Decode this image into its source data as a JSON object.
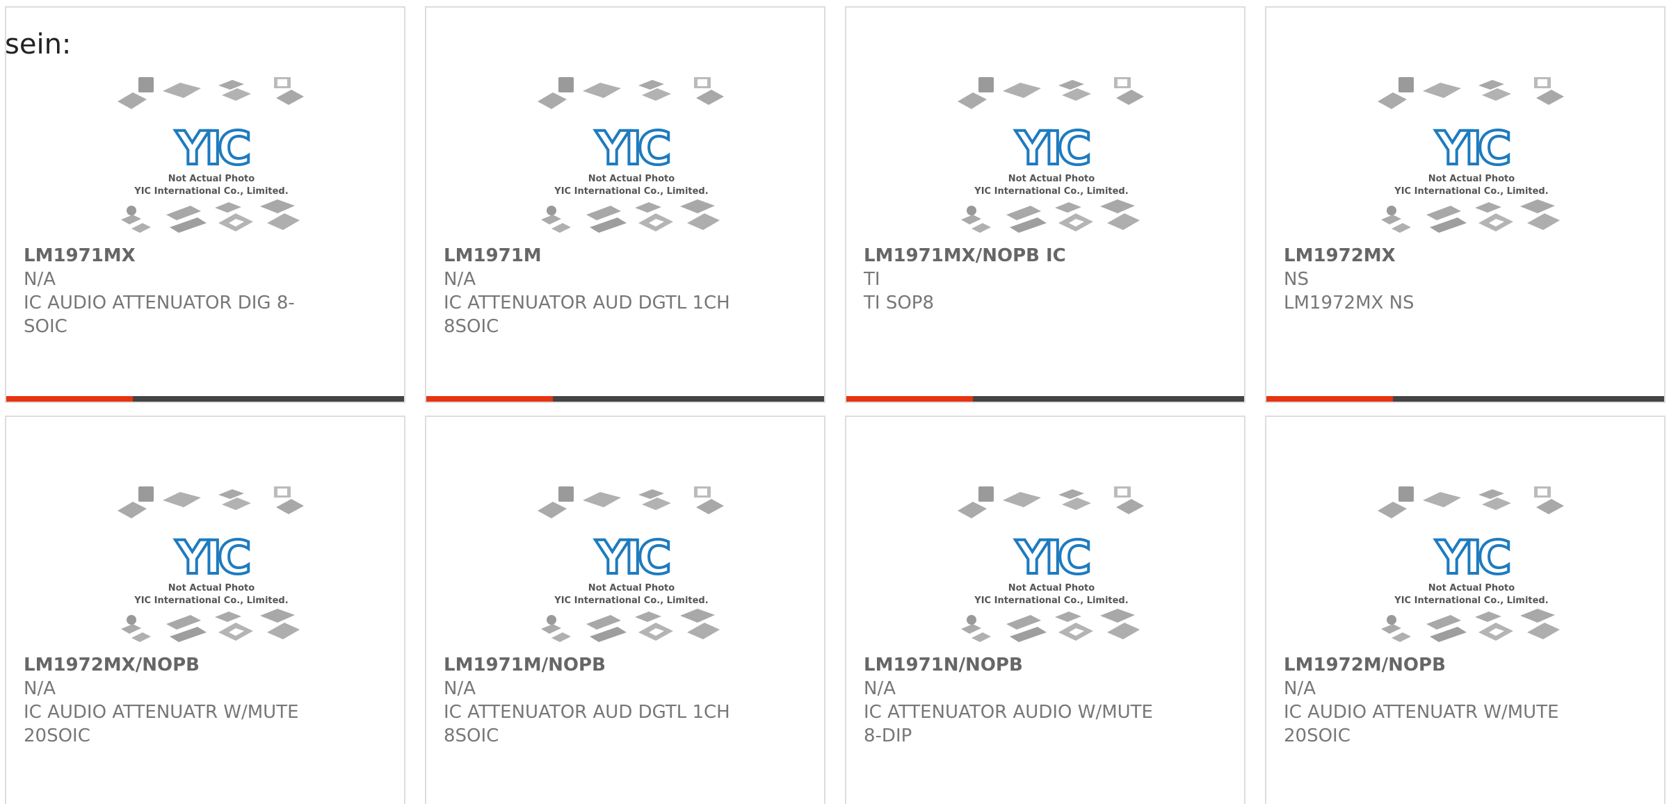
{
  "intro_text": "sein:",
  "watermark": {
    "line1": "Not Actual Photo",
    "line2": "YIC International Co., Limited.",
    "logo": "YIC"
  },
  "colors": {
    "accent": "#e63312",
    "bar": "#444444",
    "logo_blue": "#1e7bbf"
  },
  "products": [
    {
      "part": "LM1971MX",
      "manufacturer": "N/A",
      "description": "IC AUDIO ATTENUATOR DIG 8-SOIC"
    },
    {
      "part": "LM1971M",
      "manufacturer": "N/A",
      "description": "IC ATTENUATOR AUD DGTL 1CH 8SOIC"
    },
    {
      "part": "LM1971MX/NOPB IC",
      "manufacturer": "TI",
      "description": "TI SOP8"
    },
    {
      "part": "LM1972MX",
      "manufacturer": "NS",
      "description": "LM1972MX NS"
    },
    {
      "part": "LM1972MX/NOPB",
      "manufacturer": "N/A",
      "description": "IC AUDIO ATTENUATR W/MUTE 20SOIC"
    },
    {
      "part": "LM1971M/NOPB",
      "manufacturer": "N/A",
      "description": "IC ATTENUATOR AUD DGTL 1CH 8SOIC"
    },
    {
      "part": "LM1971N/NOPB",
      "manufacturer": "N/A",
      "description": "IC ATTENUATOR AUDIO W/MUTE 8-DIP"
    },
    {
      "part": "LM1972M/NOPB",
      "manufacturer": "N/A",
      "description": "IC AUDIO ATTENUATR W/MUTE 20SOIC"
    }
  ]
}
